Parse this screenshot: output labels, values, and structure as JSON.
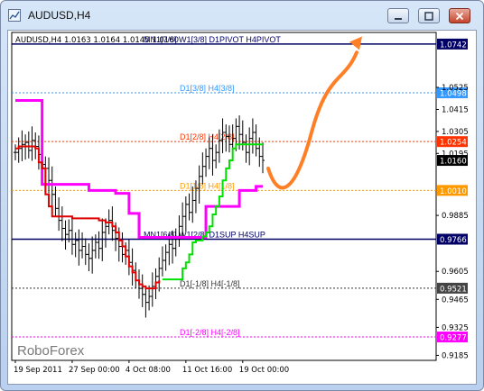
{
  "window": {
    "title": "AUDUSD,H4"
  },
  "ohlc_line": "AUDUSD,H4  1.0163 1.0164 1.0145 1.0160",
  "watermark": "RoboForex",
  "colors": {
    "magenta": "#ff00ff",
    "red": "#e00000",
    "green": "#00e000",
    "orange": "#ff7f27",
    "navy": "#000066"
  },
  "chart_data": {
    "type": "line",
    "symbol": "AUDUSD",
    "timeframe": "H4",
    "ohlc": {
      "open": 1.0163,
      "high": 1.0164,
      "low": 1.0145,
      "close": 1.016
    },
    "y_ticks": [
      1.0525,
      1.0415,
      1.0305,
      1.0195,
      0.9885,
      0.9605,
      0.9465,
      0.9325,
      0.9185
    ],
    "x_ticks": [
      "19 Sep 2011",
      "27 Sep 00:00",
      "4 Oct 08:00",
      "11 Oct 16:00",
      "19 Oct 00:00"
    ],
    "ylim": [
      0.916,
      1.08
    ],
    "levels": [
      {
        "price": 1.0742,
        "text": "MN1[7/8] W1[3/8] D1PIVOT H4PIVOT",
        "tag": "1.0742",
        "color": "#000066",
        "style": "solid",
        "tagbg": "#000066",
        "tagfg": "#ffffff"
      },
      {
        "price": 1.0498,
        "text": "D1[3/8] H4[3/8]",
        "tag": "1.0498",
        "color": "#3399ff",
        "style": "dot",
        "tagbg": "#3399ff",
        "tagfg": "#ffffff"
      },
      {
        "price": 1.0254,
        "text": "D1[2/8] H4[2/8]",
        "tag": "1.0254",
        "color": "#ff3300",
        "style": "dot",
        "tagbg": "#ff3300",
        "tagfg": "#ffffff"
      },
      {
        "price": 1.016,
        "text": "",
        "tag": "1.0160",
        "color": "#000000",
        "style": "none",
        "tagbg": "#000000",
        "tagfg": "#ffffff"
      },
      {
        "price": 1.001,
        "text": "D1[1/8] H4[1/8]",
        "tag": "1.0010",
        "color": "#ff9900",
        "style": "dot",
        "tagbg": "#ff9900",
        "tagfg": "#ffffff"
      },
      {
        "price": 0.9766,
        "text": "MN1[6/8] W1[2/8] D1SUP H4SUP",
        "tag": "0.9766",
        "color": "#000066",
        "style": "solid",
        "tagbg": "#000066",
        "tagfg": "#ffffff"
      },
      {
        "price": 0.9521,
        "text": "D1[-1/8] H4[-1/8]",
        "tag": "0.9521",
        "color": "#333333",
        "style": "dot",
        "tagbg": "#444444",
        "tagfg": "#ffffff"
      },
      {
        "price": 0.9277,
        "text": "D1[-2/8] H4[-2/8]",
        "tag": "0.9277",
        "color": "#ff00ff",
        "style": "dot",
        "tagbg": "#ff00ff",
        "tagfg": "#ffffff"
      }
    ],
    "candles_close": [
      1.02,
      1.022,
      1.024,
      1.025,
      1.021,
      1.026,
      1.023,
      1.019,
      1.014,
      1.012,
      1.006,
      0.999,
      0.992,
      0.986,
      0.982,
      0.979,
      0.981,
      0.974,
      0.976,
      0.971,
      0.973,
      0.969,
      0.967,
      0.971,
      0.975,
      0.972,
      0.98,
      0.983,
      0.986,
      0.981,
      0.977,
      0.973,
      0.969,
      0.971,
      0.965,
      0.961,
      0.956,
      0.952,
      0.949,
      0.945,
      0.948,
      0.953,
      0.958,
      0.962,
      0.966,
      0.97,
      0.974,
      0.972,
      0.978,
      0.983,
      0.988,
      0.994,
      0.99,
      0.996,
      1.002,
      1.008,
      1.013,
      1.018,
      1.022,
      1.016,
      1.02,
      1.026,
      1.03,
      1.028,
      1.024,
      1.027,
      1.033,
      1.029,
      1.025,
      1.02,
      1.027,
      1.03,
      1.022,
      1.018,
      1.016
    ],
    "series": [
      {
        "name": "",
        "color": "#ff00ff",
        "values": [
          1.046,
          1.046,
          1.046,
          1.046,
          1.046,
          1.046,
          1.046,
          1.046,
          1.004,
          1.004,
          1.004,
          1.004,
          1.004,
          1.004,
          1.004,
          1.004,
          1.004,
          1.004,
          1.004,
          1.004,
          1.004,
          1.004,
          1.001,
          1.001,
          1.001,
          1.001,
          1.001,
          1.001,
          1.001,
          1.001,
          0.9995,
          0.9995,
          0.9995,
          0.9995,
          0.9895,
          0.9895,
          0.9895,
          0.9775,
          0.9775,
          0.9775,
          0.9775,
          0.9775,
          0.9775,
          0.9775,
          0.9775,
          0.9775,
          0.9775,
          0.9775,
          0.9775,
          0.9775,
          0.9775,
          0.9775,
          0.9775,
          0.9775,
          0.9775,
          0.9775,
          0.9775,
          0.993,
          0.993,
          0.993,
          0.993,
          0.993,
          0.993,
          0.993,
          0.993,
          0.993,
          0.993,
          1.001,
          1.001,
          1.001,
          1.001,
          1.001,
          1.003,
          1.003,
          1.003
        ]
      },
      {
        "name": "",
        "color": "#e00000",
        "values": [
          1.022,
          1.023,
          1.023,
          1.023,
          1.023,
          1.023,
          1.022,
          1.015,
          1.012,
          0.999,
          0.993,
          0.988,
          0.988,
          0.988,
          0.988,
          0.988,
          0.988,
          0.987,
          0.987,
          0.987,
          0.987,
          0.987,
          0.987,
          0.987,
          0.987,
          0.986,
          0.986,
          0.985,
          0.985,
          0.983,
          0.98,
          0.976,
          0.973,
          0.968,
          0.963,
          0.96,
          0.956,
          0.954,
          0.953,
          0.952,
          0.952,
          0.952,
          0.955,
          0.956
        ]
      },
      {
        "name": "",
        "color": "#00e000",
        "values": [
          0.9565,
          0.9565,
          0.9565,
          0.9565,
          0.9565,
          0.9565,
          0.962,
          0.965,
          0.969,
          0.975,
          0.976,
          0.976,
          0.978,
          0.98,
          0.983,
          0.989,
          0.993,
          0.998,
          1.006,
          1.012,
          1.016,
          1.022,
          1.024,
          1.024,
          1.024,
          1.024,
          1.024,
          1.024,
          1.024,
          1.024,
          1.024
        ]
      }
    ],
    "series_start_index": [
      0,
      0,
      44
    ],
    "forecast_arrow": {
      "color": "#ff7f27"
    }
  }
}
